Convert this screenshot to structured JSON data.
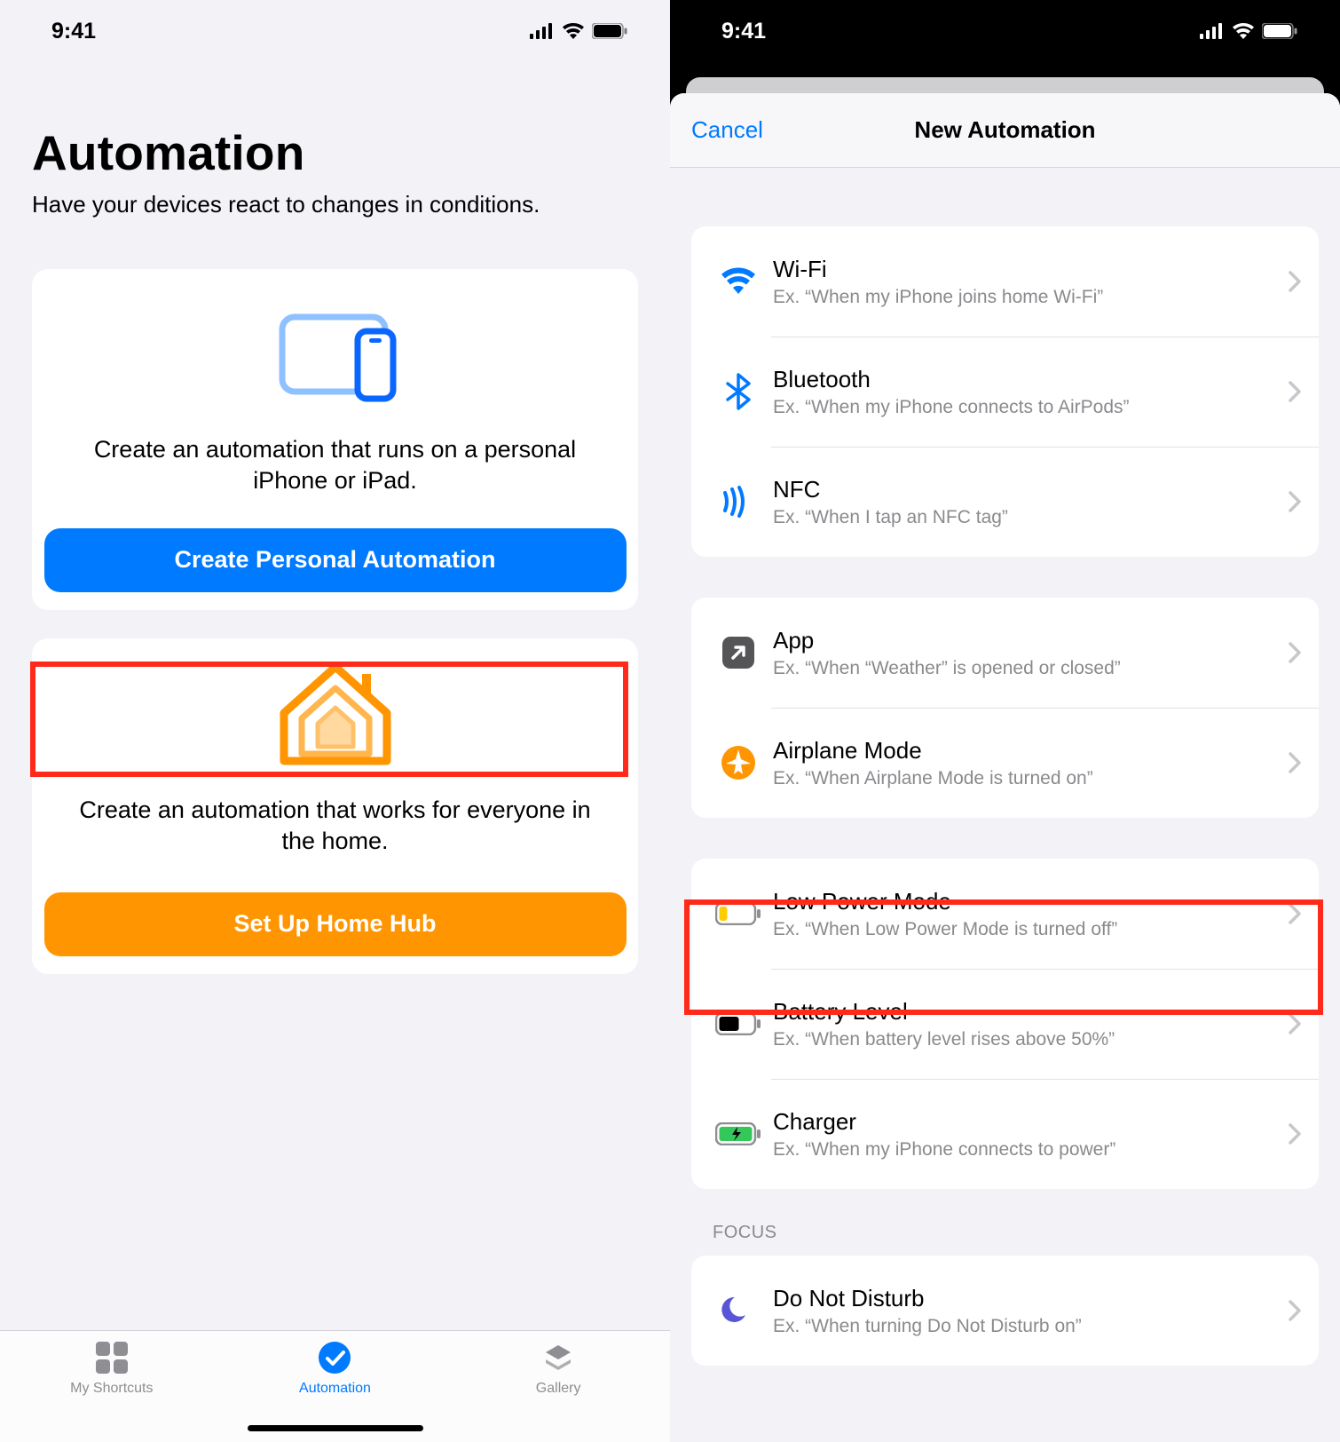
{
  "status": {
    "time": "9:41"
  },
  "left": {
    "title": "Automation",
    "subtitle": "Have your devices react to changes in conditions.",
    "card1_desc": "Create an automation that runs on a personal iPhone or iPad.",
    "card1_button": "Create Personal Automation",
    "card2_desc": "Create an automation that works for everyone in the home.",
    "card2_button": "Set Up Home Hub",
    "tabs": {
      "shortcuts": "My Shortcuts",
      "automation": "Automation",
      "gallery": "Gallery"
    }
  },
  "right": {
    "cancel": "Cancel",
    "title": "New Automation",
    "rows": {
      "wifi": {
        "title": "Wi-Fi",
        "sub": "Ex. “When my iPhone joins home Wi-Fi”"
      },
      "bluetooth": {
        "title": "Bluetooth",
        "sub": "Ex. “When my iPhone connects to AirPods”"
      },
      "nfc": {
        "title": "NFC",
        "sub": "Ex. “When I tap an NFC tag”"
      },
      "app": {
        "title": "App",
        "sub": "Ex. “When “Weather” is opened or closed”"
      },
      "airplane": {
        "title": "Airplane Mode",
        "sub": "Ex. “When Airplane Mode is turned on”"
      },
      "lpm": {
        "title": "Low Power Mode",
        "sub": "Ex. “When Low Power Mode is turned off”"
      },
      "battery": {
        "title": "Battery Level",
        "sub": "Ex. “When battery level rises above 50%”"
      },
      "charger": {
        "title": "Charger",
        "sub": "Ex. “When my iPhone connects to power”"
      },
      "dnd": {
        "title": "Do Not Disturb",
        "sub": "Ex. “When turning Do Not Disturb on”"
      }
    },
    "focus_header": "FOCUS"
  }
}
